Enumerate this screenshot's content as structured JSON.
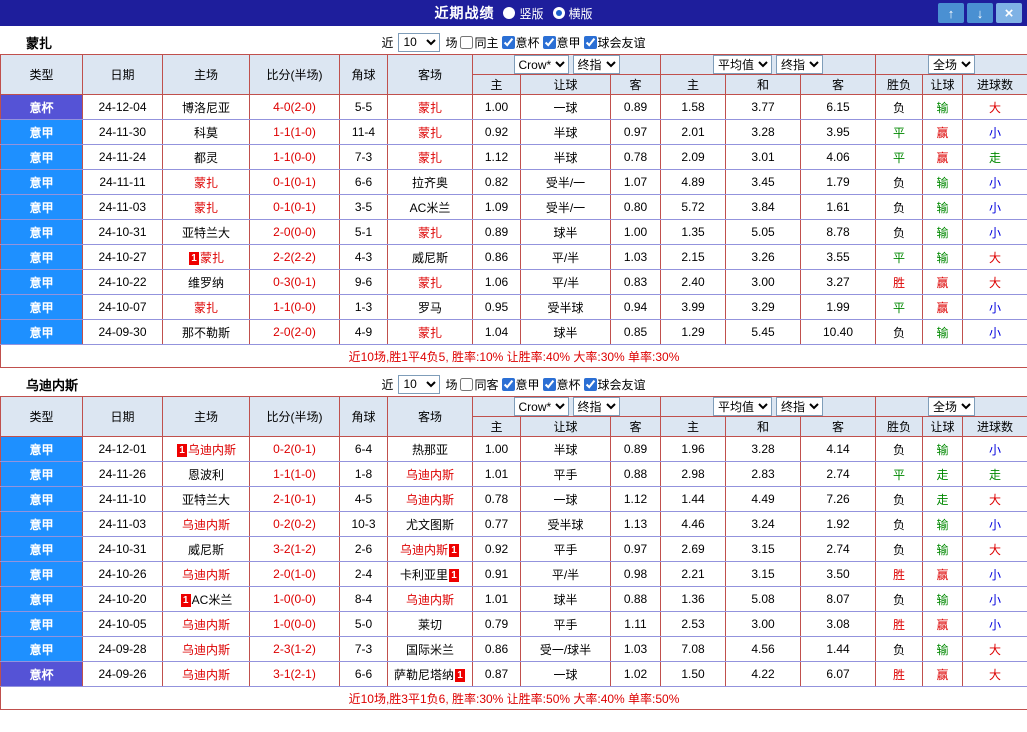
{
  "titlebar": {
    "title": "近期战绩",
    "layout_options": [
      {
        "label": "竖版",
        "selected": false
      },
      {
        "label": "横版",
        "selected": true
      }
    ],
    "buttons": {
      "up": "↑",
      "down": "↓",
      "close": "×"
    }
  },
  "colors": {
    "league_serie_a": "#1e90ff",
    "league_cup": "#5553d6",
    "accent_red": "#dd0000",
    "titlebar_bg": "#1e1e9c"
  },
  "sections": [
    {
      "team": "蒙扎",
      "filter": {
        "prefix": "近",
        "count": "10",
        "suffix": "场",
        "checkboxes": [
          {
            "label": "同主",
            "checked": false
          },
          {
            "label": "意杯",
            "checked": true
          },
          {
            "label": "意甲",
            "checked": true
          },
          {
            "label": "球会友谊",
            "checked": true
          }
        ]
      },
      "header_selects": {
        "odds_group": [
          "Crow*",
          "终指"
        ],
        "avg_group": [
          "平均值",
          "终指"
        ],
        "scope_group": [
          "全场"
        ]
      },
      "columns": [
        "类型",
        "日期",
        "主场",
        "比分(半场)",
        "角球",
        "客场",
        "主",
        "让球",
        "客",
        "主",
        "和",
        "客",
        "胜负",
        "让球",
        "进球数"
      ],
      "rows": [
        {
          "league": "意杯",
          "date": "24-12-04",
          "home": "博洛尼亚",
          "home_focal": false,
          "home_redcard": "",
          "score": "4-0(2-0)",
          "corner": "5-5",
          "away": "蒙扎",
          "away_focal": true,
          "away_redcard": "",
          "odds": [
            "1.00",
            "一球",
            "0.89"
          ],
          "avg": [
            "1.58",
            "3.77",
            "6.15"
          ],
          "result": "负",
          "handicap": "输",
          "goals": "大"
        },
        {
          "league": "意甲",
          "date": "24-11-30",
          "home": "科莫",
          "home_focal": false,
          "home_redcard": "",
          "score": "1-1(1-0)",
          "corner": "11-4",
          "away": "蒙扎",
          "away_focal": true,
          "away_redcard": "",
          "odds": [
            "0.92",
            "半球",
            "0.97"
          ],
          "avg": [
            "2.01",
            "3.28",
            "3.95"
          ],
          "result": "平",
          "handicap": "赢",
          "goals": "小"
        },
        {
          "league": "意甲",
          "date": "24-11-24",
          "home": "都灵",
          "home_focal": false,
          "home_redcard": "",
          "score": "1-1(0-0)",
          "corner": "7-3",
          "away": "蒙扎",
          "away_focal": true,
          "away_redcard": "",
          "odds": [
            "1.12",
            "半球",
            "0.78"
          ],
          "avg": [
            "2.09",
            "3.01",
            "4.06"
          ],
          "result": "平",
          "handicap": "赢",
          "goals": "走"
        },
        {
          "league": "意甲",
          "date": "24-11-11",
          "home": "蒙扎",
          "home_focal": true,
          "home_redcard": "",
          "score": "0-1(0-1)",
          "corner": "6-6",
          "away": "拉齐奥",
          "away_focal": false,
          "away_redcard": "",
          "odds": [
            "0.82",
            "受半/一",
            "1.07"
          ],
          "avg": [
            "4.89",
            "3.45",
            "1.79"
          ],
          "result": "负",
          "handicap": "输",
          "goals": "小"
        },
        {
          "league": "意甲",
          "date": "24-11-03",
          "home": "蒙扎",
          "home_focal": true,
          "home_redcard": "",
          "score": "0-1(0-1)",
          "corner": "3-5",
          "away": "AC米兰",
          "away_focal": false,
          "away_redcard": "",
          "odds": [
            "1.09",
            "受半/一",
            "0.80"
          ],
          "avg": [
            "5.72",
            "3.84",
            "1.61"
          ],
          "result": "负",
          "handicap": "输",
          "goals": "小"
        },
        {
          "league": "意甲",
          "date": "24-10-31",
          "home": "亚特兰大",
          "home_focal": false,
          "home_redcard": "",
          "score": "2-0(0-0)",
          "corner": "5-1",
          "away": "蒙扎",
          "away_focal": true,
          "away_redcard": "",
          "odds": [
            "0.89",
            "球半",
            "1.00"
          ],
          "avg": [
            "1.35",
            "5.05",
            "8.78"
          ],
          "result": "负",
          "handicap": "输",
          "goals": "小"
        },
        {
          "league": "意甲",
          "date": "24-10-27",
          "home": "蒙扎",
          "home_focal": true,
          "home_redcard": "before",
          "score": "2-2(2-2)",
          "corner": "4-3",
          "away": "威尼斯",
          "away_focal": false,
          "away_redcard": "",
          "odds": [
            "0.86",
            "平/半",
            "1.03"
          ],
          "avg": [
            "2.15",
            "3.26",
            "3.55"
          ],
          "result": "平",
          "handicap": "输",
          "goals": "大"
        },
        {
          "league": "意甲",
          "date": "24-10-22",
          "home": "维罗纳",
          "home_focal": false,
          "home_redcard": "",
          "score": "0-3(0-1)",
          "corner": "9-6",
          "away": "蒙扎",
          "away_focal": true,
          "away_redcard": "",
          "odds": [
            "1.06",
            "平/半",
            "0.83"
          ],
          "avg": [
            "2.40",
            "3.00",
            "3.27"
          ],
          "result": "胜",
          "handicap": "赢",
          "goals": "大"
        },
        {
          "league": "意甲",
          "date": "24-10-07",
          "home": "蒙扎",
          "home_focal": true,
          "home_redcard": "",
          "score": "1-1(0-0)",
          "corner": "1-3",
          "away": "罗马",
          "away_focal": false,
          "away_redcard": "",
          "odds": [
            "0.95",
            "受半球",
            "0.94"
          ],
          "avg": [
            "3.99",
            "3.29",
            "1.99"
          ],
          "result": "平",
          "handicap": "赢",
          "goals": "小"
        },
        {
          "league": "意甲",
          "date": "24-09-30",
          "home": "那不勒斯",
          "home_focal": false,
          "home_redcard": "",
          "score": "2-0(2-0)",
          "corner": "4-9",
          "away": "蒙扎",
          "away_focal": true,
          "away_redcard": "",
          "odds": [
            "1.04",
            "球半",
            "0.85"
          ],
          "avg": [
            "1.29",
            "5.45",
            "10.40"
          ],
          "result": "负",
          "handicap": "输",
          "goals": "小"
        }
      ],
      "summary": "近10场,胜1平4负5, 胜率:10% 让胜率:40% 大率:30% 单率:30%"
    },
    {
      "team": "乌迪内斯",
      "filter": {
        "prefix": "近",
        "count": "10",
        "suffix": "场",
        "checkboxes": [
          {
            "label": "同客",
            "checked": false
          },
          {
            "label": "意甲",
            "checked": true
          },
          {
            "label": "意杯",
            "checked": true
          },
          {
            "label": "球会友谊",
            "checked": true
          }
        ]
      },
      "header_selects": {
        "odds_group": [
          "Crow*",
          "终指"
        ],
        "avg_group": [
          "平均值",
          "终指"
        ],
        "scope_group": [
          "全场"
        ]
      },
      "columns": [
        "类型",
        "日期",
        "主场",
        "比分(半场)",
        "角球",
        "客场",
        "主",
        "让球",
        "客",
        "主",
        "和",
        "客",
        "胜负",
        "让球",
        "进球数"
      ],
      "rows": [
        {
          "league": "意甲",
          "date": "24-12-01",
          "home": "乌迪内斯",
          "home_focal": true,
          "home_redcard": "before",
          "score": "0-2(0-1)",
          "corner": "6-4",
          "away": "热那亚",
          "away_focal": false,
          "away_redcard": "",
          "odds": [
            "1.00",
            "半球",
            "0.89"
          ],
          "avg": [
            "1.96",
            "3.28",
            "4.14"
          ],
          "result": "负",
          "handicap": "输",
          "goals": "小"
        },
        {
          "league": "意甲",
          "date": "24-11-26",
          "home": "恩波利",
          "home_focal": false,
          "home_redcard": "",
          "score": "1-1(1-0)",
          "corner": "1-8",
          "away": "乌迪内斯",
          "away_focal": true,
          "away_redcard": "",
          "odds": [
            "1.01",
            "平手",
            "0.88"
          ],
          "avg": [
            "2.98",
            "2.83",
            "2.74"
          ],
          "result": "平",
          "handicap": "走",
          "goals": "走"
        },
        {
          "league": "意甲",
          "date": "24-11-10",
          "home": "亚特兰大",
          "home_focal": false,
          "home_redcard": "",
          "score": "2-1(0-1)",
          "corner": "4-5",
          "away": "乌迪内斯",
          "away_focal": true,
          "away_redcard": "",
          "odds": [
            "0.78",
            "一球",
            "1.12"
          ],
          "avg": [
            "1.44",
            "4.49",
            "7.26"
          ],
          "result": "负",
          "handicap": "走",
          "goals": "大"
        },
        {
          "league": "意甲",
          "date": "24-11-03",
          "home": "乌迪内斯",
          "home_focal": true,
          "home_redcard": "",
          "score": "0-2(0-2)",
          "corner": "10-3",
          "away": "尤文图斯",
          "away_focal": false,
          "away_redcard": "",
          "odds": [
            "0.77",
            "受半球",
            "1.13"
          ],
          "avg": [
            "4.46",
            "3.24",
            "1.92"
          ],
          "result": "负",
          "handicap": "输",
          "goals": "小"
        },
        {
          "league": "意甲",
          "date": "24-10-31",
          "home": "威尼斯",
          "home_focal": false,
          "home_redcard": "",
          "score": "3-2(1-2)",
          "corner": "2-6",
          "away": "乌迪内斯",
          "away_focal": true,
          "away_redcard": "after",
          "odds": [
            "0.92",
            "平手",
            "0.97"
          ],
          "avg": [
            "2.69",
            "3.15",
            "2.74"
          ],
          "result": "负",
          "handicap": "输",
          "goals": "大"
        },
        {
          "league": "意甲",
          "date": "24-10-26",
          "home": "乌迪内斯",
          "home_focal": true,
          "home_redcard": "",
          "score": "2-0(1-0)",
          "corner": "2-4",
          "away": "卡利亚里",
          "away_focal": false,
          "away_redcard": "after",
          "odds": [
            "0.91",
            "平/半",
            "0.98"
          ],
          "avg": [
            "2.21",
            "3.15",
            "3.50"
          ],
          "result": "胜",
          "handicap": "赢",
          "goals": "小"
        },
        {
          "league": "意甲",
          "date": "24-10-20",
          "home": "AC米兰",
          "home_focal": false,
          "home_redcard": "before",
          "score": "1-0(0-0)",
          "corner": "8-4",
          "away": "乌迪内斯",
          "away_focal": true,
          "away_redcard": "",
          "odds": [
            "1.01",
            "球半",
            "0.88"
          ],
          "avg": [
            "1.36",
            "5.08",
            "8.07"
          ],
          "result": "负",
          "handicap": "输",
          "goals": "小"
        },
        {
          "league": "意甲",
          "date": "24-10-05",
          "home": "乌迪内斯",
          "home_focal": true,
          "home_redcard": "",
          "score": "1-0(0-0)",
          "corner": "5-0",
          "away": "莱切",
          "away_focal": false,
          "away_redcard": "",
          "odds": [
            "0.79",
            "平手",
            "1.11"
          ],
          "avg": [
            "2.53",
            "3.00",
            "3.08"
          ],
          "result": "胜",
          "handicap": "赢",
          "goals": "小"
        },
        {
          "league": "意甲",
          "date": "24-09-28",
          "home": "乌迪内斯",
          "home_focal": true,
          "home_redcard": "",
          "score": "2-3(1-2)",
          "corner": "7-3",
          "away": "国际米兰",
          "away_focal": false,
          "away_redcard": "",
          "odds": [
            "0.86",
            "受一/球半",
            "1.03"
          ],
          "avg": [
            "7.08",
            "4.56",
            "1.44"
          ],
          "result": "负",
          "handicap": "输",
          "goals": "大"
        },
        {
          "league": "意杯",
          "date": "24-09-26",
          "home": "乌迪内斯",
          "home_focal": true,
          "home_redcard": "",
          "score": "3-1(2-1)",
          "corner": "6-6",
          "away": "萨勒尼塔纳",
          "away_focal": false,
          "away_redcard": "after",
          "odds": [
            "0.87",
            "一球",
            "1.02"
          ],
          "avg": [
            "1.50",
            "4.22",
            "6.07"
          ],
          "result": "胜",
          "handicap": "赢",
          "goals": "大"
        }
      ],
      "summary": "近10场,胜3平1负6, 胜率:30% 让胜率:50% 大率:40% 单率:50%"
    }
  ]
}
